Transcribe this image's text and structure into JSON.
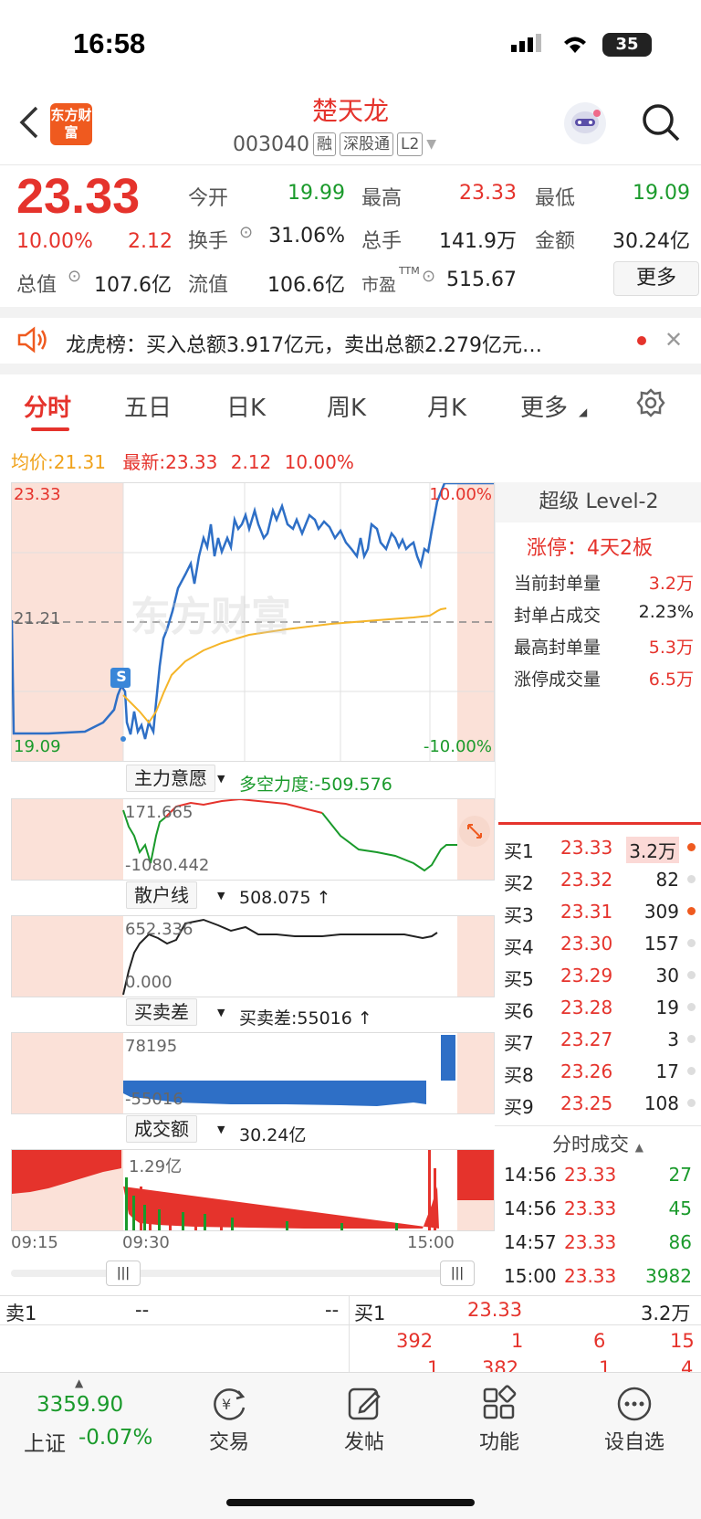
{
  "status_bar": {
    "time": "16:58",
    "battery": "35"
  },
  "header": {
    "logo": "东方财富",
    "title": "楚天龙",
    "code": "003040",
    "tags": [
      "融",
      "深股通",
      "L2"
    ]
  },
  "quote": {
    "price": "23.33",
    "pct": "10.00%",
    "change": "2.12",
    "rows": [
      [
        {
          "l": "今开",
          "v": "19.99",
          "c": "green"
        },
        {
          "l": "最高",
          "v": "23.33",
          "c": "red"
        },
        {
          "l": "最低",
          "v": "19.09",
          "c": "green"
        }
      ],
      [
        {
          "l": "换手",
          "v": "31.06%",
          "c": ""
        },
        {
          "l": "总手",
          "v": "141.9万",
          "c": ""
        },
        {
          "l": "金额",
          "v": "30.24亿",
          "c": ""
        }
      ]
    ],
    "total_value_label": "总值",
    "total_value": "107.6亿",
    "float_label": "流值",
    "float_value": "106.6亿",
    "pe_label": "市盈",
    "pe_sup": "TTM",
    "pe_value": "515.67",
    "more": "更多"
  },
  "notice": {
    "text": "龙虎榜：买入总额3.917亿元，卖出总额2.279亿元…"
  },
  "tabs": [
    "分时",
    "五日",
    "日K",
    "周K",
    "月K",
    "更多"
  ],
  "avg_line": {
    "avg_label": "均价:",
    "avg": "21.31",
    "latest_label": "最新:",
    "latest": "23.33",
    "change": "2.12",
    "pct": "10.00%"
  },
  "chart": {
    "y_top": "23.33",
    "y_mid": "21.21",
    "y_bot": "19.09",
    "pct_top": "10.00%",
    "pct_bot": "-10.00%",
    "s_marker": "S",
    "watermark": "东方财富",
    "x_labels": [
      "09:15",
      "09:30",
      "15:00"
    ]
  },
  "indicators": [
    {
      "name": "主力意愿",
      "value": "多空力度:-509.576",
      "top": "171.665",
      "bottom": "-1080.442"
    },
    {
      "name": "散户线",
      "value": "508.075 ↑",
      "top": "652.336",
      "bottom": "0.000"
    },
    {
      "name": "买卖差",
      "value": "买卖差:55016 ↑",
      "top": "78195",
      "bottom": "-55016"
    },
    {
      "name": "成交额",
      "value": "30.24亿",
      "top": "1.29亿"
    }
  ],
  "level2": {
    "title": "超级 Level-2",
    "limit_label": "涨停：",
    "limit_value": "4天2板",
    "stats": [
      {
        "l": "当前封单量",
        "v": "3.2万"
      },
      {
        "l": "封单占成交",
        "v": "2.23%"
      },
      {
        "l": "最高封单量",
        "v": "5.3万"
      },
      {
        "l": "涨停成交量",
        "v": "6.5万"
      }
    ]
  },
  "orderbook": [
    {
      "l": "买1",
      "p": "23.33",
      "v": "3.2万"
    },
    {
      "l": "买2",
      "p": "23.32",
      "v": "82"
    },
    {
      "l": "买3",
      "p": "23.31",
      "v": "309"
    },
    {
      "l": "买4",
      "p": "23.30",
      "v": "157"
    },
    {
      "l": "买5",
      "p": "23.29",
      "v": "30"
    },
    {
      "l": "买6",
      "p": "23.28",
      "v": "19"
    },
    {
      "l": "买7",
      "p": "23.27",
      "v": "3"
    },
    {
      "l": "买8",
      "p": "23.26",
      "v": "17"
    },
    {
      "l": "买9",
      "p": "23.25",
      "v": "108"
    }
  ],
  "trades_title": "分时成交",
  "trades": [
    {
      "t": "14:56",
      "p": "23.33",
      "v": "27"
    },
    {
      "t": "14:56",
      "p": "23.33",
      "v": "45"
    },
    {
      "t": "14:57",
      "p": "23.33",
      "v": "86"
    },
    {
      "t": "15:00",
      "p": "23.33",
      "v": "3982"
    }
  ],
  "bottom_quote": {
    "sell_label": "卖1",
    "sell_a": "--",
    "sell_b": "--",
    "buy_label": "买1",
    "buy_price": "23.33",
    "buy_vol": "3.2万",
    "queue": [
      "392",
      "1",
      "6",
      "15"
    ],
    "queue2": [
      "1",
      "382",
      "1",
      "4"
    ]
  },
  "bottom_nav": {
    "index_value": "3359.90",
    "index_name": "上证",
    "index_pct": "-0.07%",
    "items": [
      "交易",
      "发帖",
      "功能",
      "设自选"
    ]
  }
}
